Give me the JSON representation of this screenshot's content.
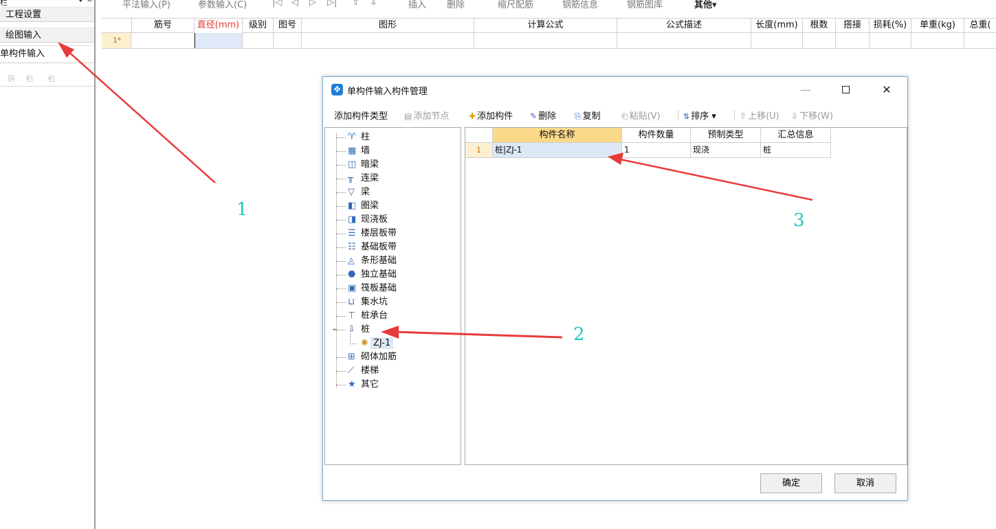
{
  "left_panel": {
    "title": "栏",
    "pin": "♦ ×",
    "nav": [
      "工程设置",
      "绘图输入",
      "单构件输入"
    ],
    "tools": [
      "⎘",
      "⎗",
      "⎗"
    ]
  },
  "top_toolbar": {
    "items": [
      "平法输入(P)",
      "参数输入(C)",
      "|◁",
      "◁",
      "▷",
      "▷|",
      "⇧",
      "⇩",
      "插入",
      "删除",
      "缩尺配筋",
      "钢筋信息",
      "钢筋图库",
      "其他▾"
    ]
  },
  "grid": {
    "headers": [
      "",
      "筋号",
      "直径(mm)",
      "级别",
      "图号",
      "图形",
      "计算公式",
      "公式描述",
      "长度(mm)",
      "根数",
      "搭接",
      "损耗(%)",
      "单重(kg)",
      "总重("
    ],
    "row_num": "1*"
  },
  "dialog": {
    "title": "单构件输入构件管理",
    "icon": "✥",
    "win_min": "—",
    "win_close": "✕",
    "toolbar": {
      "add_type": "添加构件类型",
      "add_node": "添加节点",
      "add_member": "添加构件",
      "delete": "删除",
      "copy": "复制",
      "paste": "粘贴(V)",
      "sort": "排序 ▾",
      "move_up": "上移(U)",
      "move_down": "下移(W)"
    },
    "tree": [
      {
        "label": "柱",
        "icon": "♈"
      },
      {
        "label": "墙",
        "icon": "▦"
      },
      {
        "label": "暗梁",
        "icon": "◫"
      },
      {
        "label": "连梁",
        "icon": "╥"
      },
      {
        "label": "梁",
        "icon": "▽"
      },
      {
        "label": "圈梁",
        "icon": "◧"
      },
      {
        "label": "现浇板",
        "icon": "◨"
      },
      {
        "label": "楼层板带",
        "icon": "☰"
      },
      {
        "label": "基础板带",
        "icon": "☷"
      },
      {
        "label": "条形基础",
        "icon": "◬"
      },
      {
        "label": "独立基础",
        "icon": "⬣"
      },
      {
        "label": "筏板基础",
        "icon": "▣"
      },
      {
        "label": "集水坑",
        "icon": "⊔"
      },
      {
        "label": "桩承台",
        "icon": "⊤"
      },
      {
        "label": "桩",
        "icon": "⇩",
        "expanded": true
      },
      {
        "label": "砌体加筋",
        "icon": "⊞"
      },
      {
        "label": "楼梯",
        "icon": "⟋"
      },
      {
        "label": "其它",
        "icon": "★"
      }
    ],
    "tree_child": {
      "label": "ZJ-1",
      "icon": "✺"
    },
    "list": {
      "headers": [
        "构件名称",
        "构件数量",
        "预制类型",
        "汇总信息"
      ],
      "rows": [
        {
          "num": "1",
          "name": "桩|ZJ-1",
          "count": "1",
          "type": "现浇",
          "summary": "桩"
        }
      ]
    },
    "ok": "确定",
    "cancel": "取消"
  },
  "annotations": [
    "1",
    "2",
    "3"
  ],
  "colors": {
    "arrow": "#e83a3a",
    "annotation_number": "#20c7c0",
    "selected_header": "#fbd98a",
    "selection": "#dde8f6",
    "row_number_bg": "#fdf0d1"
  }
}
